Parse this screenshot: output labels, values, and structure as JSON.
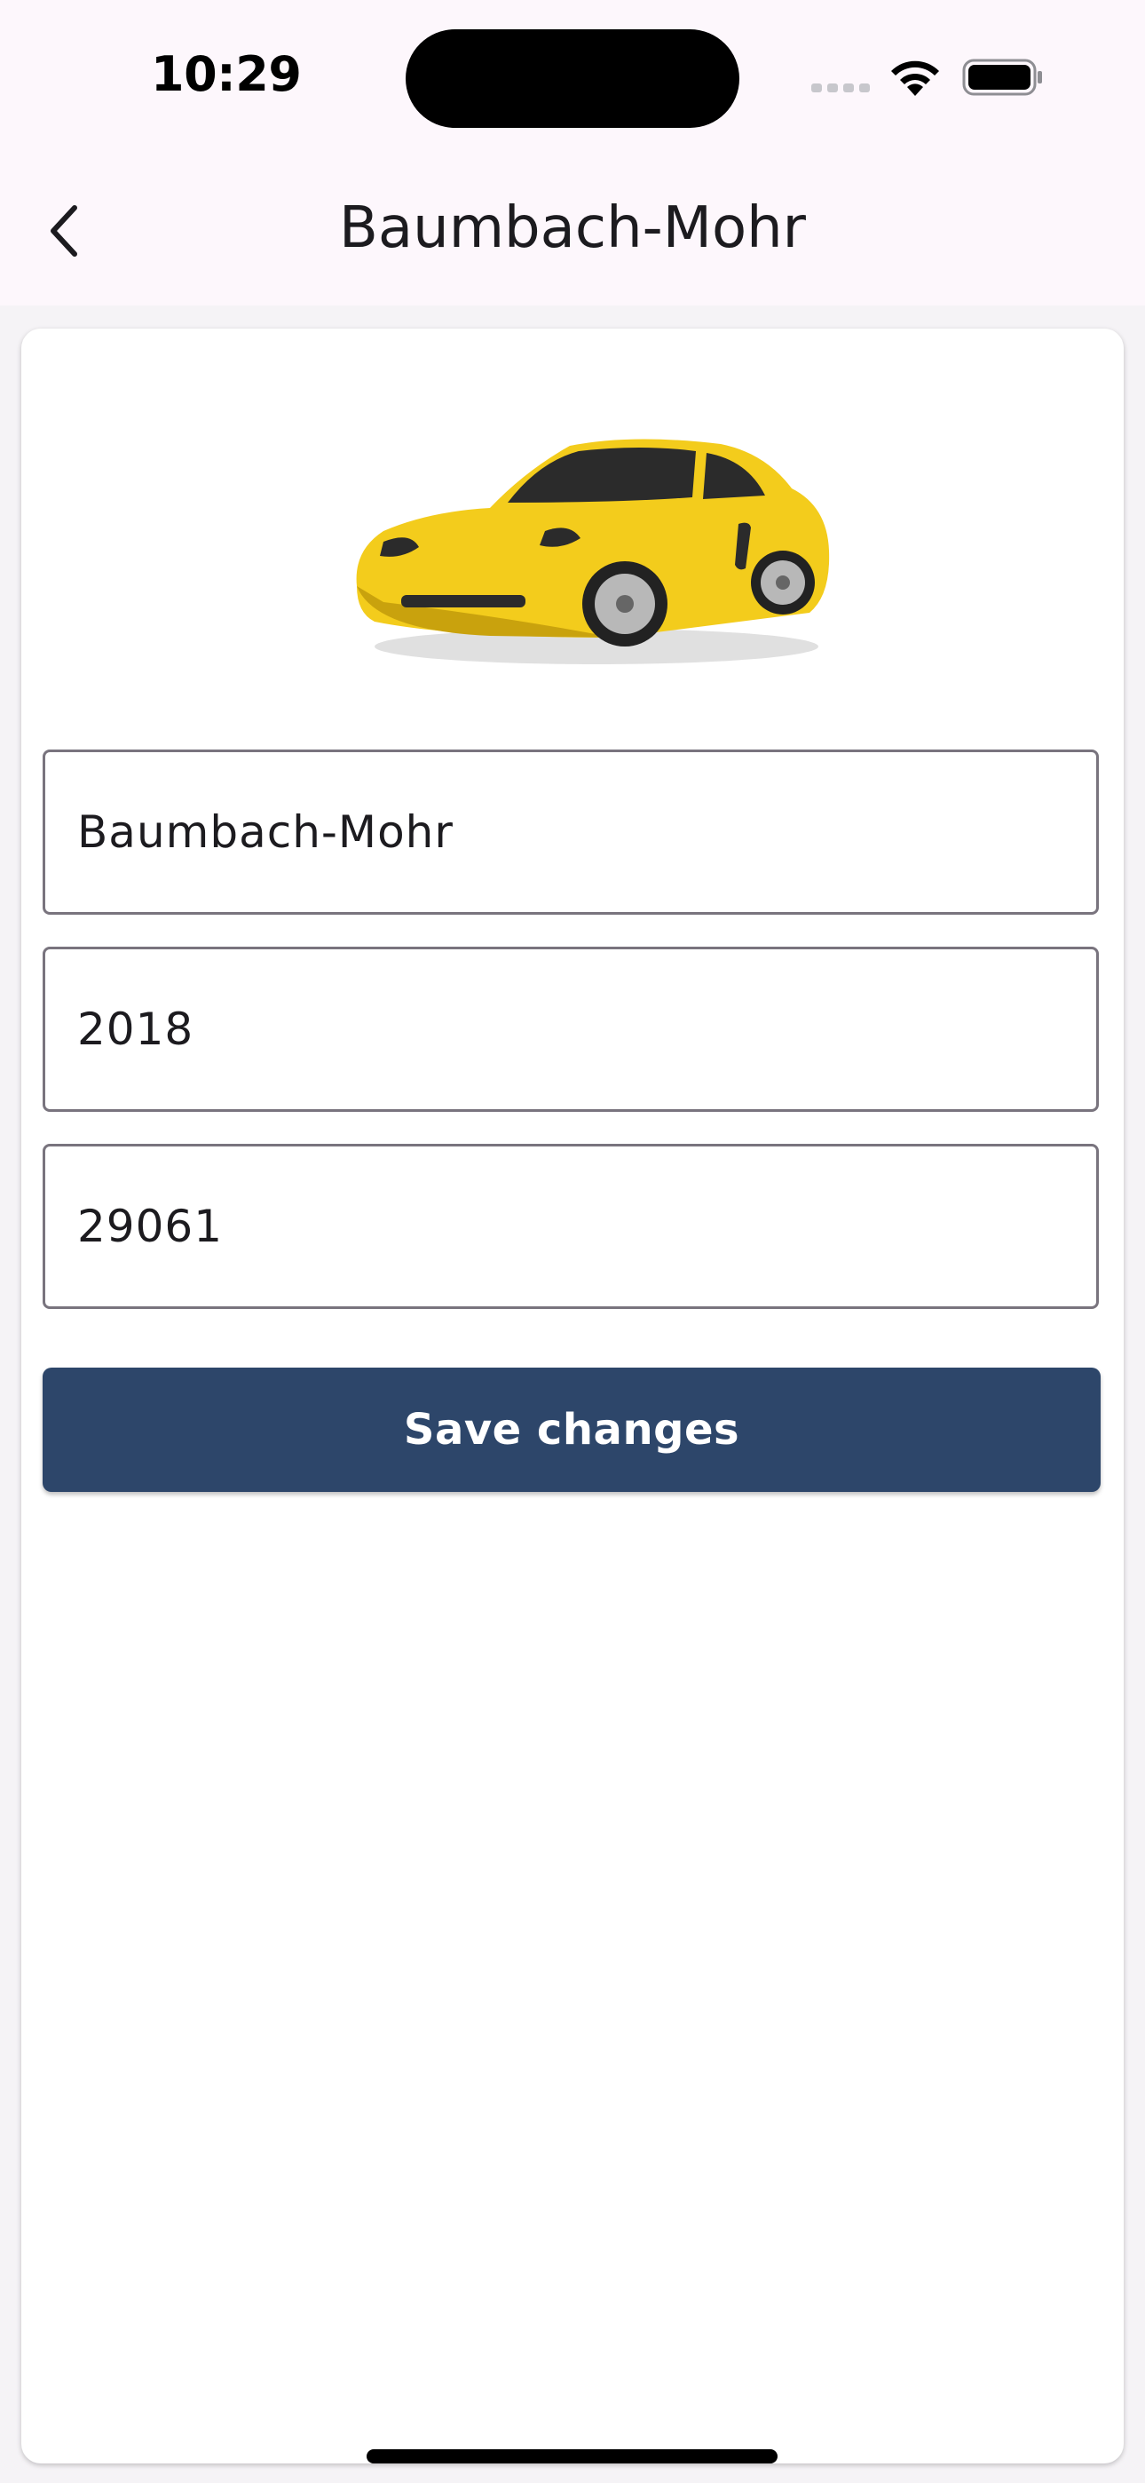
{
  "status_bar": {
    "time": "10:29",
    "signal_icon": "cellular-signal-dots-icon",
    "wifi_icon": "wifi-icon",
    "battery_icon": "battery-full-icon"
  },
  "app_bar": {
    "back_icon": "chevron-left-icon",
    "title": "Baumbach-Mohr"
  },
  "vehicle_image": {
    "subject": "yellow sports coupe",
    "colors": {
      "body": "#f3cc1c",
      "body_shadow": "#c9a20d",
      "window": "#2b2b2b",
      "wheel": "#b8b8b8"
    }
  },
  "form": {
    "fields": [
      {
        "value": "Baumbach-Mohr"
      },
      {
        "value": "2018"
      },
      {
        "value": "29061"
      }
    ],
    "save_label": "Save changes"
  },
  "colors": {
    "app_bar_background": "#fdf7fc",
    "button_background": "#2d466a",
    "field_border": "#79747e"
  }
}
